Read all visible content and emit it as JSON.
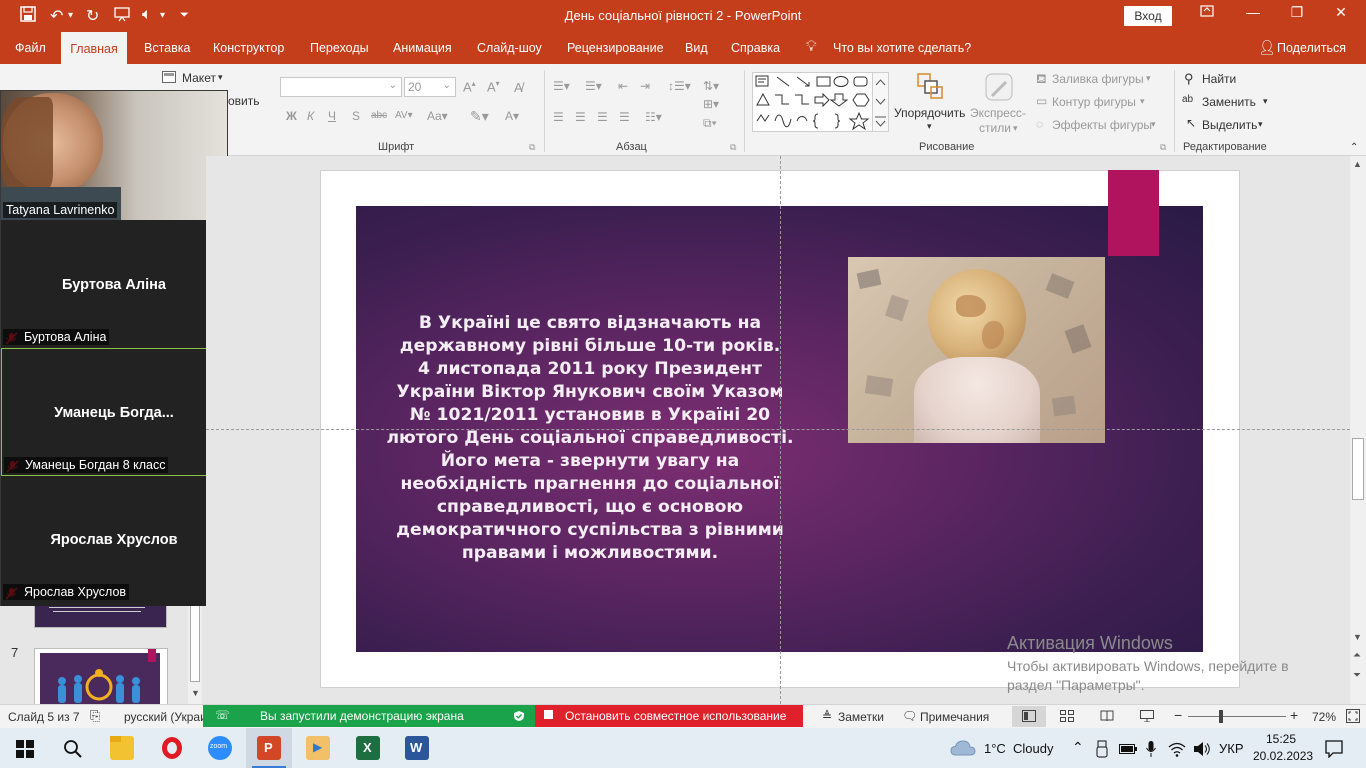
{
  "window": {
    "title": "День соціальної рівності 2  -  PowerPoint",
    "signin_label": "Вход",
    "minimize_glyph": "—",
    "restore_glyph": "❐",
    "close_glyph": "✕"
  },
  "ribbon": {
    "tabs": [
      "Файл",
      "Главная",
      "Вставка",
      "Конструктор",
      "Переходы",
      "Анимация",
      "Слайд-шоу",
      "Рецензирование",
      "Вид",
      "Справка"
    ],
    "tell_me": "Что вы хотите сделать?",
    "share": "Поделиться",
    "clipboard": {
      "layout": "Макет",
      "partial": "овить"
    },
    "font": {
      "size": "20",
      "label": "Шрифт"
    },
    "paragraph": {
      "label": "Абзац"
    },
    "drawing": {
      "label": "Рисование",
      "arrange": "Упорядочить",
      "quick_styles_1": "Экспресс-",
      "quick_styles_2": "стили",
      "fill": "Заливка фигуры",
      "outline": "Контур фигуры",
      "effects": "Эффекты фигуры"
    },
    "editing": {
      "label": "Редактирование",
      "find": "Найти",
      "replace": "Заменить",
      "select": "Выделить"
    }
  },
  "zoom": {
    "participants": [
      {
        "display": "",
        "label": "Tatyana Lavrinenko"
      },
      {
        "display": "Буртова Аліна",
        "label": "Буртова Аліна"
      },
      {
        "display": "Уманець  Богда...",
        "label": "Уманець Богдан 8 класс"
      },
      {
        "display": "Ярослав Хруслов",
        "label": "Ярослав Хруслов"
      }
    ]
  },
  "thumbnails": {
    "slide7_number": "7"
  },
  "slide": {
    "lines": [
      "В Україні це свято відзначають на",
      "державному рівні більше 10-ти років.",
      "4  листопада 2011 року Президент",
      "України Віктор Янукович своїм Указом",
      "№ 1021/2011 установив в Україні 20",
      "лютого День соціальної справедливості.",
      "Його мета - звернути увагу на",
      "необхідність прагнення до соціальної",
      "справедливості, що є основою",
      "демократичного суспільства з рівними",
      "правами і можливостями."
    ]
  },
  "activation": {
    "title": "Активация Windows",
    "line1": "Чтобы активировать Windows, перейдите в",
    "line2": "раздел \"Параметры\"."
  },
  "statusbar": {
    "slide_counter": "Слайд 5 из 7",
    "language": "русский (Украи",
    "sharing": "Вы запустили демонстрацию экрана",
    "stop_sharing": "Остановить совместное использование",
    "notes": "Заметки",
    "comments": "Примечания",
    "zoom_level": "72%"
  },
  "taskbar": {
    "weather_temp": "1°C",
    "weather_desc": "Cloudy",
    "lang": "УКР",
    "time": "15:25",
    "date": "20.02.2023"
  },
  "colors": {
    "accent": "#c43e1c",
    "slide_accent": "#b0145e",
    "share_green": "#1aa34a",
    "share_red": "#e0202a"
  }
}
